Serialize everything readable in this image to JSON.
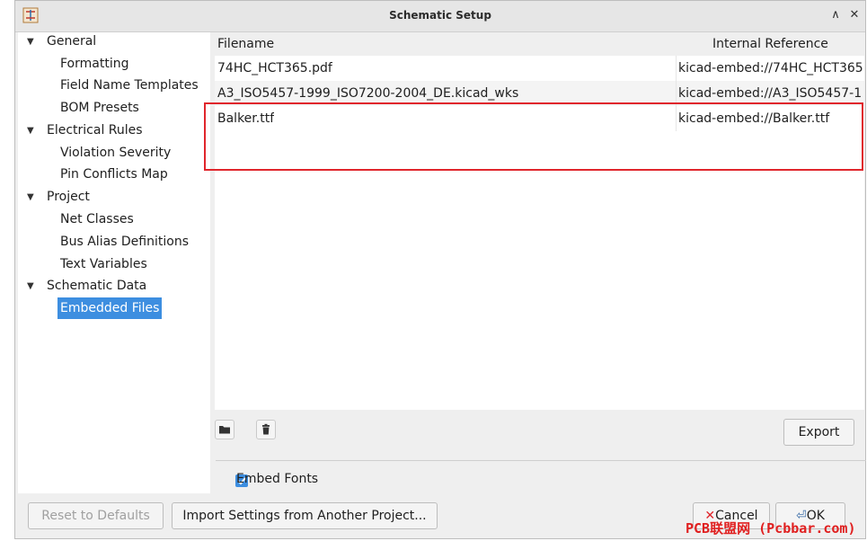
{
  "window": {
    "title": "Schematic Setup"
  },
  "titlebar": {
    "minimize_glyph": "∧",
    "close_glyph": "✕"
  },
  "sidebar": {
    "items": [
      {
        "label": "General",
        "expanded": true
      },
      {
        "label": "Formatting"
      },
      {
        "label": "Field Name Templates"
      },
      {
        "label": "BOM Presets"
      },
      {
        "label": "Electrical Rules",
        "expanded": true
      },
      {
        "label": "Violation Severity"
      },
      {
        "label": "Pin Conflicts Map"
      },
      {
        "label": "Project",
        "expanded": true
      },
      {
        "label": "Net Classes"
      },
      {
        "label": "Bus Alias Definitions"
      },
      {
        "label": "Text Variables"
      },
      {
        "label": "Schematic Data",
        "expanded": true
      },
      {
        "label": "Embedded Files",
        "selected": true
      }
    ]
  },
  "table": {
    "columns": [
      "Filename",
      "Internal Reference"
    ],
    "rows": [
      {
        "filename": "74HC_HCT365.pdf",
        "reference": "kicad-embed://74HC_HCT365"
      },
      {
        "filename": "A3_ISO5457-1999_ISO7200-2004_DE.kicad_wks",
        "reference": "kicad-embed://A3_ISO5457-1"
      },
      {
        "filename": "Balker.ttf",
        "reference": "kicad-embed://Balker.ttf"
      }
    ]
  },
  "toolbar": {
    "add_icon": "folder-icon",
    "delete_icon": "trash-icon",
    "export_label": "Export"
  },
  "options": {
    "embed_fonts_label": "Embed Fonts",
    "embed_fonts_checked": true
  },
  "footer": {
    "reset_label": "Reset to Defaults",
    "import_label": "Import Settings from Another Project...",
    "cancel_label": "Cancel",
    "ok_label": "OK"
  },
  "watermark": "PCB联盟网 (Pcbbar.com)",
  "colors": {
    "selection": "#3d8ee0",
    "highlight_box": "#e0262c",
    "watermark": "#e02020"
  }
}
